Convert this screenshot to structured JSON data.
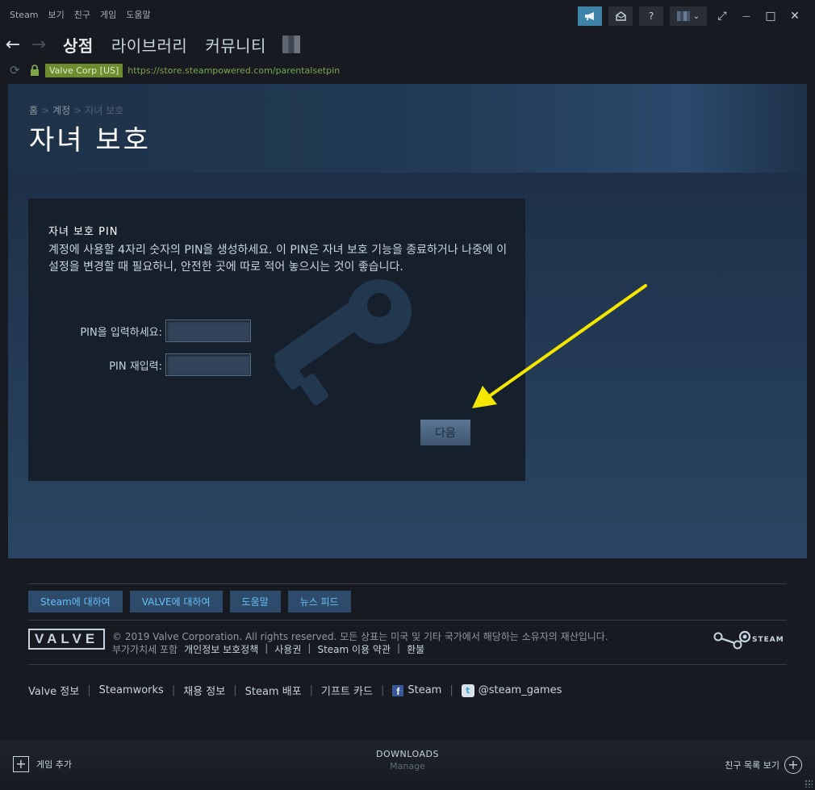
{
  "menubar": {
    "items": [
      "Steam",
      "보기",
      "친구",
      "게임",
      "도움말"
    ]
  },
  "topright": {
    "announce_icon": "megaphone-icon",
    "mail_icon": "envelope-icon",
    "help_label": "?",
    "dropdown_glyph": "⌄"
  },
  "window_controls": {
    "restore": "⤢",
    "minimize": "—",
    "maximize": "□",
    "close": "✕"
  },
  "nav": {
    "back": "←",
    "forward": "→",
    "tabs": [
      "상점",
      "라이브러리",
      "커뮤니티"
    ]
  },
  "urlbar": {
    "reload": "⟳",
    "cert": "Valve Corp [US]",
    "url": "https://store.steampowered.com/parentalsetpin"
  },
  "breadcrumb": [
    "홈",
    "계정",
    "자녀 보호"
  ],
  "breadcrumb_sep": ">",
  "page_title": "자녀 보호",
  "panel": {
    "title": "자녀 보호 PIN",
    "description": "계정에 사용할 4자리 숫자의 PIN을 생성하세요. 이 PIN은 자녀 보호 기능을 종료하거나 나중에 이 설정을 변경할 때 필요하니, 안전한 곳에 따로 적어 놓으시는 것이 좋습니다.",
    "pin_label": "PIN을 입력하세요:",
    "pin_value": "",
    "pin_confirm_label": "PIN 재입력:",
    "pin_confirm_value": "",
    "next_button": "다음"
  },
  "footer": {
    "buttons": [
      "Steam에 대하여",
      "VALVE에 대하여",
      "도움말",
      "뉴스 피드"
    ],
    "valve_logo": "VALVE",
    "copyright": "© 2019 Valve Corporation. All rights reserved. 모든 상표는 미국 및 기타 국가에서 해당하는 소유자의 재산입니다.",
    "vat_note": "부가가치세 포함",
    "legal_links": [
      "개인정보 보호정책",
      "사용권",
      "Steam 이용 약관",
      "환불"
    ],
    "legal_sep": "|",
    "steam_logo": "STEAM",
    "links": [
      "Valve 정보",
      "Steamworks",
      "채용 정보",
      "Steam 배포",
      "기프트 카드"
    ],
    "link_sep": "|",
    "facebook_label": "Steam",
    "facebook_icon": "f",
    "twitter_label": "@steam_games",
    "twitter_icon": "t"
  },
  "bottombar": {
    "add_game": "게임 추가",
    "plus_glyph": "+",
    "downloads_title": "DOWNLOADS",
    "downloads_sub": "Manage",
    "friends": "친구 목록 보기"
  },
  "colors": {
    "accent": "#66c0f4",
    "url_green": "#7ea64b",
    "cert_bg": "#6c8c2e",
    "annotation_arrow": "#f5e600",
    "page_bg": "#1b2838"
  }
}
